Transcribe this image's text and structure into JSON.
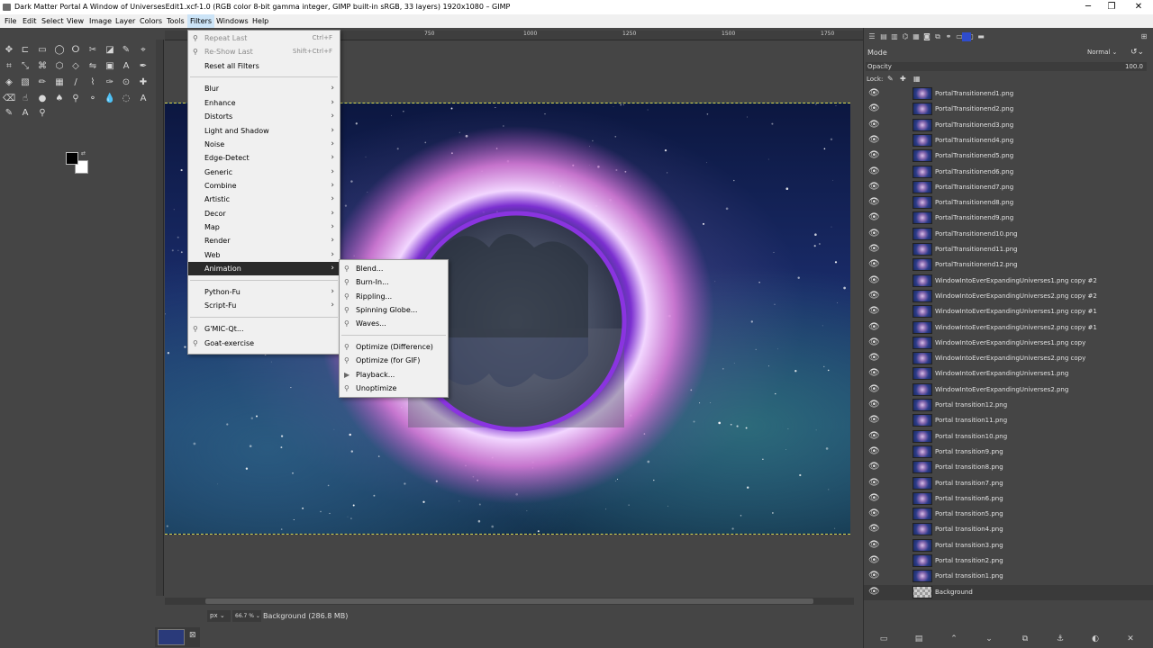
{
  "window": {
    "title": "Dark Matter Portal A Window of UniversesEdit1.xcf-1.0 (RGB color 8-bit gamma integer, GIMP built-in sRGB, 33 layers) 1920x1080 – GIMP",
    "minimize": "─",
    "maximize": "❐",
    "close": "✕"
  },
  "menubar": [
    "File",
    "Edit",
    "Select",
    "View",
    "Image",
    "Layer",
    "Colors",
    "Tools",
    "Filters",
    "Windows",
    "Help"
  ],
  "filters_menu": {
    "top": [
      {
        "label": "Repeat Last",
        "shortcut": "Ctrl+F",
        "disabled": true
      },
      {
        "label": "Re-Show Last",
        "shortcut": "Shift+Ctrl+F",
        "disabled": true
      },
      {
        "label": "Reset all Filters",
        "shortcut": "",
        "disabled": false
      }
    ],
    "submenus": [
      "Blur",
      "Enhance",
      "Distorts",
      "Light and Shadow",
      "Noise",
      "Edge-Detect",
      "Generic",
      "Combine",
      "Artistic",
      "Decor",
      "Map",
      "Render",
      "Web",
      "Animation"
    ],
    "scripts": [
      "Python-Fu",
      "Script-Fu"
    ],
    "plugins": [
      "G'MIC-Qt...",
      "Goat-exercise"
    ]
  },
  "animation_menu": {
    "group1": [
      "Blend...",
      "Burn-In...",
      "Rippling...",
      "Spinning Globe...",
      "Waves..."
    ],
    "group2": [
      "Optimize (Difference)",
      "Optimize (for GIF)",
      "Playback...",
      "Unoptimize"
    ]
  },
  "ruler": {
    "labels": [
      "750",
      "1000",
      "1250",
      "1500",
      "1750"
    ]
  },
  "status": {
    "unit": "px",
    "zoom": "66.7 %",
    "text": "Background (286.8 MB)"
  },
  "dock": {
    "mode_label": "Mode",
    "mode_value": "Normal",
    "opacity_label": "Opacity",
    "opacity_value": "100.0",
    "lock_label": "Lock:"
  },
  "layers": [
    "PortalTransitionend1.png",
    "PortalTransitionend2.png",
    "PortalTransitionend3.png",
    "PortalTransitionend4.png",
    "PortalTransitionend5.png",
    "PortalTransitionend6.png",
    "PortalTransitionend7.png",
    "PortalTransitionend8.png",
    "PortalTransitionend9.png",
    "PortalTransitionend10.png",
    "PortalTransitionend11.png",
    "PortalTransitionend12.png",
    "WindowIntoEverExpandingUniverses1.png copy #2",
    "WindowIntoEverExpandingUniverses2.png copy #2",
    "WindowIntoEverExpandingUniverses1.png copy #1",
    "WindowIntoEverExpandingUniverses2.png copy #1",
    "WindowIntoEverExpandingUniverses1.png copy",
    "WindowIntoEverExpandingUniverses2.png copy",
    "WindowIntoEverExpandingUniverses1.png",
    "WindowIntoEverExpandingUniverses2.png",
    "Portal transition12.png",
    "Portal transition11.png",
    "Portal transition10.png",
    "Portal transition9.png",
    "Portal transition8.png",
    "Portal transition7.png",
    "Portal transition6.png",
    "Portal transition5.png",
    "Portal transition4.png",
    "Portal transition3.png",
    "Portal transition2.png",
    "Portal transition1.png",
    "Background"
  ],
  "icons": {
    "eye": "visibility-eye-icon",
    "submenu": "chevron-right-icon",
    "plugin": "plugin-icon"
  }
}
